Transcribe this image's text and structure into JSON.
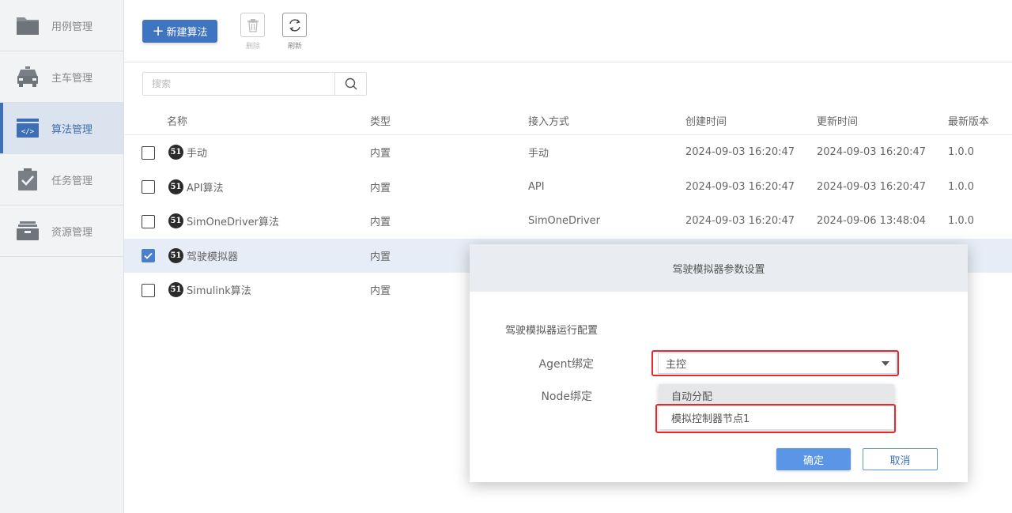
{
  "sidebar": {
    "items": [
      {
        "label": "用例管理",
        "icon": "folder-icon",
        "active": false
      },
      {
        "label": "主车管理",
        "icon": "car-icon",
        "active": false
      },
      {
        "label": "算法管理",
        "icon": "code-icon",
        "active": true
      },
      {
        "label": "任务管理",
        "icon": "clipboard-check-icon",
        "active": false
      },
      {
        "label": "资源管理",
        "icon": "archive-box-icon",
        "active": false
      }
    ]
  },
  "toolbar": {
    "new_label": "新建算法",
    "delete_label": "删除",
    "refresh_label": "刷新"
  },
  "search": {
    "placeholder": "搜索"
  },
  "table": {
    "headers": {
      "name": "名称",
      "type": "类型",
      "access": "接入方式",
      "created": "创建时间",
      "updated": "更新时间",
      "version": "最新版本"
    },
    "rows": [
      {
        "name": "手动",
        "type": "内置",
        "access": "手动",
        "created": "2024-09-03 16:20:47",
        "updated": "2024-09-03 16:20:47",
        "version": "1.0.0",
        "checked": false
      },
      {
        "name": "API算法",
        "type": "内置",
        "access": "API",
        "created": "2024-09-03 16:20:47",
        "updated": "2024-09-03 16:20:47",
        "version": "1.0.0",
        "checked": false
      },
      {
        "name": "SimOneDriver算法",
        "type": "内置",
        "access": "SimOneDriver",
        "created": "2024-09-03 16:20:47",
        "updated": "2024-09-06 13:48:04",
        "version": "1.0.0",
        "checked": false
      },
      {
        "name": "驾驶模拟器",
        "type": "内置",
        "access": "",
        "created": "",
        "updated": "",
        "version": "",
        "checked": true
      },
      {
        "name": "Simulink算法",
        "type": "内置",
        "access": "",
        "created": "",
        "updated": "",
        "version": "",
        "checked": false
      }
    ],
    "logo_text": "51"
  },
  "modal": {
    "title": "驾驶模拟器参数设置",
    "section_title": "驾驶模拟器运行配置",
    "agent_label": "Agent绑定",
    "agent_value": "主控",
    "node_label": "Node绑定",
    "node_options": [
      "自动分配",
      "模拟控制器节点1"
    ],
    "ok_label": "确定",
    "cancel_label": "取消"
  },
  "colors": {
    "primary": "#3f74c0",
    "highlight_red": "#e8262e",
    "selected_row": "#e7edf6"
  }
}
